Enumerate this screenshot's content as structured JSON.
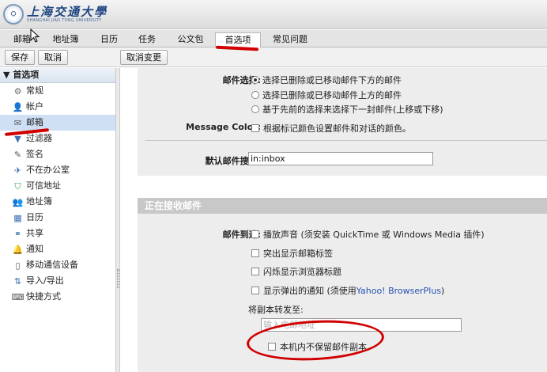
{
  "header": {
    "logo_cn": "上海交通大學",
    "logo_en": "SHANGHAI JIAO TONG UNIVERSITY"
  },
  "tabs": [
    {
      "label": "邮箱"
    },
    {
      "label": "地址簿"
    },
    {
      "label": "日历"
    },
    {
      "label": "任务"
    },
    {
      "label": "公文包"
    },
    {
      "label": "首选项"
    },
    {
      "label": "常见问题"
    }
  ],
  "toolbar": {
    "save": "保存",
    "cancel": "取消",
    "undo": "取消变更"
  },
  "sidebar": {
    "heading": "首选项",
    "items": [
      {
        "label": "常规",
        "icon": "gear-icon"
      },
      {
        "label": "帐户",
        "icon": "account-icon"
      },
      {
        "label": "邮箱",
        "icon": "mail-icon"
      },
      {
        "label": "过滤器",
        "icon": "filter-icon"
      },
      {
        "label": "签名",
        "icon": "signature-icon"
      },
      {
        "label": "不在办公室",
        "icon": "out-of-office-icon"
      },
      {
        "label": "可信地址",
        "icon": "shield-icon"
      },
      {
        "label": "地址簿",
        "icon": "contacts-icon"
      },
      {
        "label": "日历",
        "icon": "calendar-icon"
      },
      {
        "label": "共享",
        "icon": "sharing-icon"
      },
      {
        "label": "通知",
        "icon": "bell-icon"
      },
      {
        "label": "移动通信设备",
        "icon": "mobile-icon"
      },
      {
        "label": "导入/导出",
        "icon": "import-export-icon"
      },
      {
        "label": "快捷方式",
        "icon": "shortcut-icon"
      }
    ]
  },
  "mail_select": {
    "label": "邮件选择:",
    "options": [
      {
        "text": "选择已删除或已移动邮件下方的邮件",
        "selected": true
      },
      {
        "text": "选择已删除或已移动邮件上方的邮件",
        "selected": false
      },
      {
        "text": "基于先前的选择来选择下一封邮件(上移或下移)",
        "selected": false
      }
    ]
  },
  "message_color": {
    "label": "Message Color:",
    "option": "根据标记颜色设置邮件和对话的颜色。"
  },
  "default_search": {
    "label": "默认邮件搜索:",
    "value": "in:inbox"
  },
  "receiving": {
    "heading": "正在接收邮件",
    "arrival_label": "邮件到达:",
    "play_sound": "播放声音 (须安装 QuickTime 或 Windows Media 插件)",
    "highlight_tab": "突出显示邮箱标签",
    "flash_title": "闪烁显示浏览器标题",
    "popup_prefix": "显示弹出的通知 (须使用 ",
    "popup_link": "Yahoo! BrowserPlus",
    "popup_suffix": ")",
    "forward_label": "将副本转发至:",
    "forward_placeholder": "输入电邮地址",
    "no_local_copy": "本机内不保留邮件副本"
  },
  "colors": {
    "annotation": "#d00000",
    "section_head": "#c8c8c8",
    "panel": "#ededed",
    "link": "#2452b5"
  }
}
